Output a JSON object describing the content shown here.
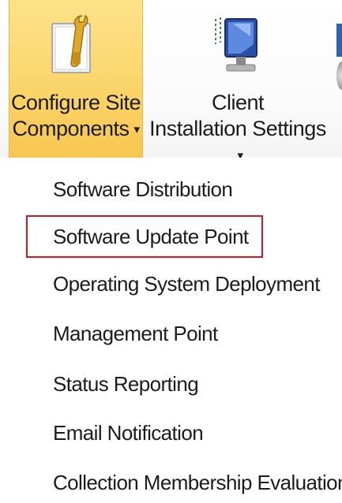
{
  "ribbon": {
    "configure": {
      "line1": "Configure Site",
      "line2": "Components",
      "caret": "▾",
      "icon": "configure-site-components-icon"
    },
    "client": {
      "line1": "Client",
      "line2": "Installation Settings",
      "caret": "▾",
      "icon": "client-installation-icon"
    }
  },
  "menu": {
    "items": [
      {
        "label": "Software Distribution"
      },
      {
        "label": "Software Update Point"
      },
      {
        "label": "Operating System Deployment"
      },
      {
        "label": "Management Point"
      },
      {
        "label": "Status Reporting"
      },
      {
        "label": "Email Notification"
      },
      {
        "label": "Collection Membership Evaluation"
      }
    ],
    "highlighted_index": 1
  },
  "colors": {
    "accent_active": "#fbd56a",
    "highlight_border": "#e0141e"
  }
}
